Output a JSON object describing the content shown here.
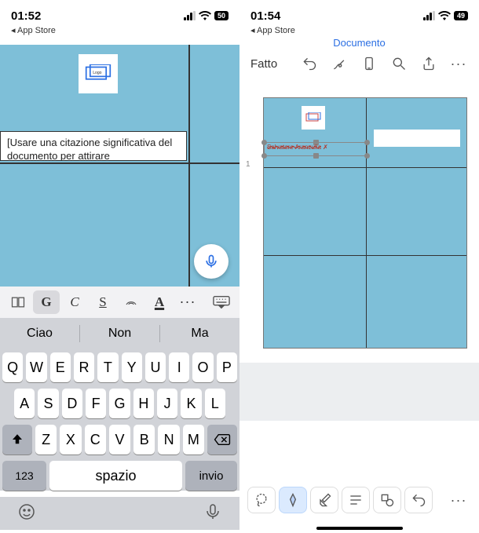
{
  "left": {
    "status": {
      "time": "01:52",
      "back": "App Store",
      "battery": "50"
    },
    "quote": "[Usare una citazione significativa del documento per attirare",
    "format": {
      "bold": "G",
      "italic": "C",
      "underline": "S",
      "more": "···"
    },
    "suggestions": [
      "Ciao",
      "Non",
      "Ma"
    ],
    "kbd": {
      "r1": [
        "Q",
        "W",
        "E",
        "R",
        "T",
        "Y",
        "U",
        "I",
        "O",
        "P"
      ],
      "r2": [
        "A",
        "S",
        "D",
        "F",
        "G",
        "H",
        "J",
        "K",
        "L"
      ],
      "r3": [
        "Z",
        "X",
        "C",
        "V",
        "B",
        "N",
        "M"
      ],
      "num": "123",
      "space": "spazio",
      "enter": "invio"
    }
  },
  "right": {
    "status": {
      "time": "01:54",
      "back": "App Store",
      "battery": "49"
    },
    "title": "Documento",
    "done": "Fatto",
    "author": "Salvatore Aranzulla",
    "more": "···",
    "page": "1"
  }
}
